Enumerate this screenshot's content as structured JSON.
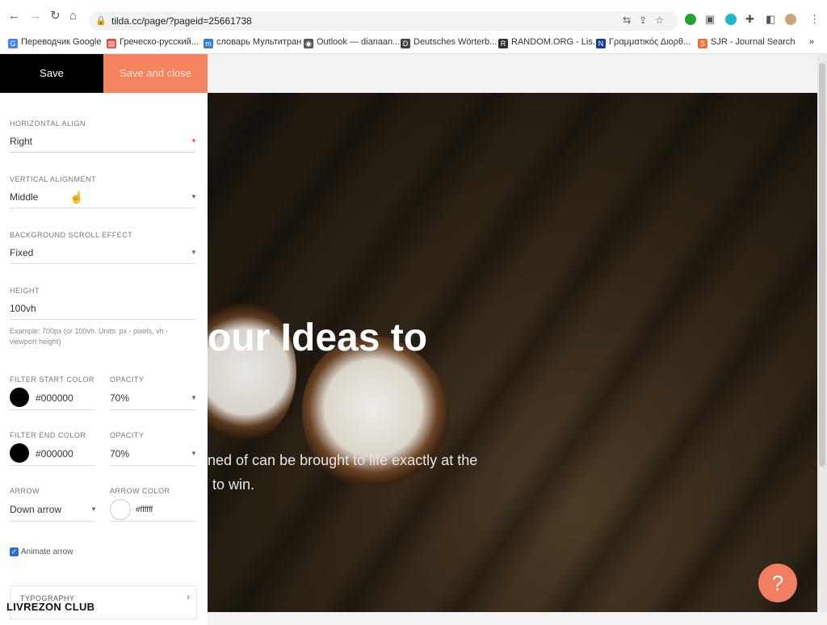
{
  "browser": {
    "url": "tilda.cc/page/?pageid=25661738",
    "bookmarks": [
      {
        "label": "Переводчик Google",
        "icon": "google-translate-icon",
        "color": "#4285f4"
      },
      {
        "label": "Греческо-русский...",
        "icon": "page-icon",
        "color": "#d9534f"
      },
      {
        "label": "словарь Мультитран",
        "icon": "multitran-icon",
        "color": "#3a7bd5"
      },
      {
        "label": "Outlook — dianaan...",
        "icon": "globe-icon",
        "color": "#555555"
      },
      {
        "label": "Deutsches Wörterb...",
        "icon": "dwds-icon",
        "color": "#444444"
      },
      {
        "label": "RANDOM.ORG - Lis...",
        "icon": "random-org-icon",
        "color": "#333333"
      },
      {
        "label": "Γραμματικός Διορθ...",
        "icon": "n-icon",
        "color": "#1a3d8f"
      },
      {
        "label": "SJR - Journal Search",
        "icon": "sjr-icon",
        "color": "#e8743b"
      }
    ],
    "more_bookmarks": "»"
  },
  "toolbar": {
    "save_label": "Save",
    "save_close_label": "Save and close"
  },
  "settings": {
    "horizontal_align": {
      "label": "HORIZONTAL ALIGN",
      "value": "Right"
    },
    "vertical_alignment": {
      "label": "VERTICAL ALIGNMENT",
      "value": "Middle"
    },
    "background_scroll_effect": {
      "label": "BACKGROUND SCROLL EFFECT",
      "value": "Fixed"
    },
    "height": {
      "label": "HEIGHT",
      "value": "100vh",
      "hint": "Example: 700px (or 100vh. Units: px - pixels, vh - viewport height)"
    },
    "filter_start_color": {
      "label": "FILTER START COLOR",
      "value": "#000000",
      "swatch": "#000000"
    },
    "filter_start_opacity": {
      "label": "OPACITY",
      "value": "70%"
    },
    "filter_end_color": {
      "label": "FILTER END COLOR",
      "value": "#000000",
      "swatch": "#000000"
    },
    "filter_end_opacity": {
      "label": "OPACITY",
      "value": "70%"
    },
    "arrow": {
      "label": "ARROW",
      "value": "Down arrow"
    },
    "arrow_color": {
      "label": "ARROW COLOR",
      "value": "#ffffff",
      "swatch": "#ffffff"
    },
    "animate_arrow": {
      "label": "Animate arrow",
      "checked": true
    },
    "typography": {
      "label": "TYPOGRAPHY"
    }
  },
  "preview": {
    "title": "our Ideas to",
    "subtitle_line1": "ned of can be brought to life exactly at the",
    "subtitle_line2": "to win.",
    "help_label": "?"
  },
  "watermark": "LIVREZON CLUB",
  "colors": {
    "accent": "#f4845f",
    "help_button": "#f07f62",
    "checkbox": "#2a6fd6"
  }
}
